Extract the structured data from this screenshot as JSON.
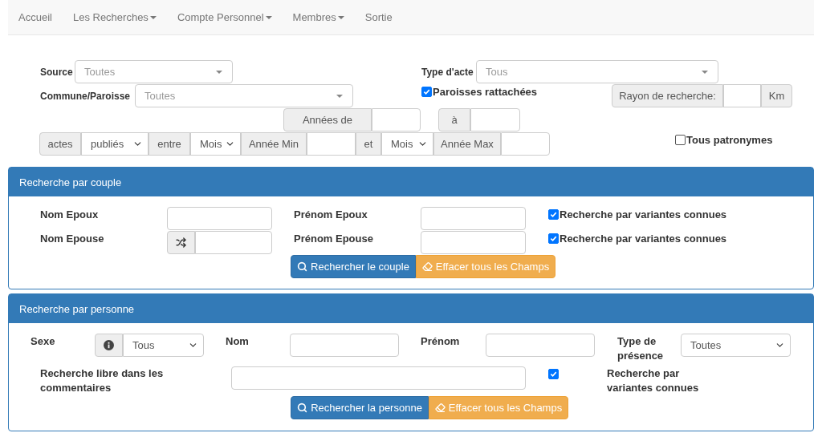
{
  "nav": [
    {
      "label": "Accueil",
      "dropdown": false
    },
    {
      "label": "Les Recherches",
      "dropdown": true
    },
    {
      "label": "Compte Personnel",
      "dropdown": true
    },
    {
      "label": "Membres",
      "dropdown": true
    },
    {
      "label": "Sortie",
      "dropdown": false
    }
  ],
  "filters": {
    "source": {
      "label": "Source",
      "placeholder": "Toutes"
    },
    "type_acte": {
      "label": "Type d'acte",
      "placeholder": "Tous"
    },
    "commune": {
      "label": "Commune/Paroisse",
      "placeholder": "Toutes"
    },
    "paroisses_rattachees": {
      "label": "Paroisses rattachées",
      "checked": true
    },
    "rayon": {
      "label": "Rayon de recherche:",
      "unit": "Km"
    },
    "annees": {
      "from_label": "Années de",
      "to_label": "à"
    },
    "period": [
      {
        "kind": "addon",
        "text": "actes"
      },
      {
        "kind": "select",
        "text": "publiés"
      },
      {
        "kind": "addon",
        "text": "entre"
      },
      {
        "kind": "select",
        "text": "Mois"
      },
      {
        "kind": "addon",
        "text": "Année Min"
      },
      {
        "kind": "input"
      },
      {
        "kind": "addon",
        "text": "et"
      },
      {
        "kind": "select",
        "text": "Mois"
      },
      {
        "kind": "addon",
        "text": "Année Max"
      },
      {
        "kind": "input"
      }
    ],
    "tous_patronymes": {
      "label": "Tous patronymes",
      "checked": false
    }
  },
  "couple_panel": {
    "title": "Recherche par couple",
    "rows": [
      {
        "name_label": "Nom Epoux",
        "shuffle": false,
        "first_name_label": "Prénom Epoux",
        "variants": {
          "label": "Recherche par variantes connues",
          "checked": true
        }
      },
      {
        "name_label": "Nom Epouse",
        "shuffle": true,
        "first_name_label": "Prénom Epouse",
        "variants": {
          "label": "Recherche par variantes connues",
          "checked": true
        }
      }
    ],
    "buttons": [
      {
        "kind": "primary",
        "label": "Rechercher le couple"
      },
      {
        "kind": "warning",
        "label": "Effacer tous les Champs"
      }
    ]
  },
  "person_panel": {
    "title": "Recherche par personne",
    "sexe": {
      "label": "Sexe",
      "value": "Tous"
    },
    "nom_label": "Nom",
    "prenom_label": "Prénom",
    "presence": {
      "label": "Type de présence",
      "value": "Toutes"
    },
    "comments_label": "Recherche libre dans les commentaires",
    "variants": {
      "label": "Recherche par variantes connues",
      "checked": true
    },
    "buttons": [
      {
        "kind": "primary",
        "label": "Rechercher la personne"
      },
      {
        "kind": "warning",
        "label": "Effacer tous les Champs"
      }
    ]
  }
}
